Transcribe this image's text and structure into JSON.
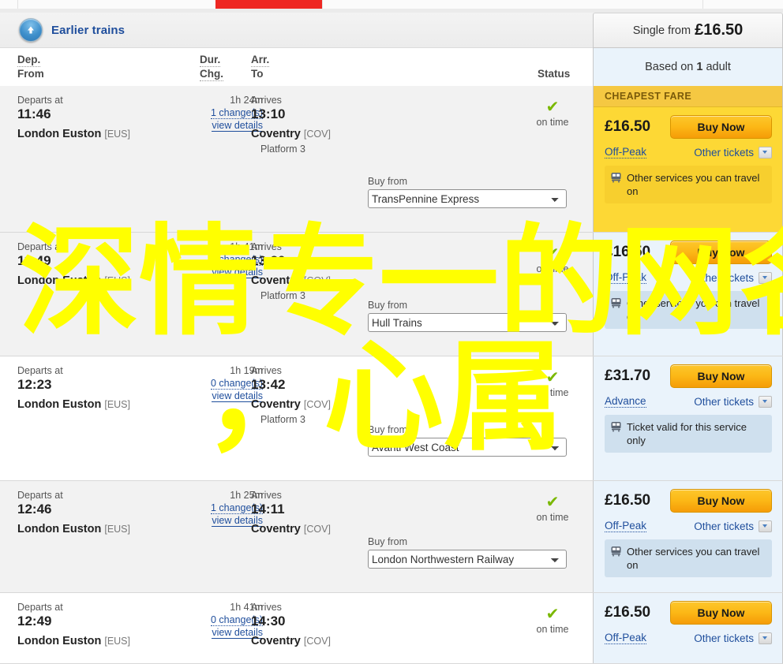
{
  "toolbar": {
    "earlier_trains_label": "Earlier trains",
    "earlier_icon": "up-arrow-icon"
  },
  "columns": {
    "dep": "Dep.",
    "from": "From",
    "dur": "Dur.",
    "chg": "Chg.",
    "arr": "Arr.",
    "to": "To",
    "status": "Status"
  },
  "fare_header": {
    "single_from_label": "Single from",
    "single_from_price": "£16.50",
    "based_on_prefix": "Based on",
    "based_on_count": "1",
    "based_on_suffix": "adult"
  },
  "labels": {
    "departs_at": "Departs at",
    "arrives": "Arrives",
    "view_details": "view details",
    "buy_from": "Buy from",
    "on_time": "on time",
    "buy_now": "Buy Now",
    "other_tickets": "Other tickets",
    "cheapest_fare": "CHEAPEST FARE"
  },
  "results": [
    {
      "depart_time": "11:46",
      "from_station": "London Euston",
      "from_code": "[EUS]",
      "duration": "1h 24m",
      "changes": "1 change(s)",
      "arrive_time": "13:10",
      "to_station": "Coventry",
      "to_code": "[COV]",
      "platform": "Platform 3",
      "status": "on time",
      "operator": "TransPennine Express",
      "price": "£16.50",
      "fare_type": "Off-Peak",
      "note": "Other services you can travel on",
      "cheapest": true,
      "panel": "cheapest",
      "row_shade": "alt"
    },
    {
      "depart_time": "11:49",
      "from_station": "London Euston",
      "from_code": "[EUS]",
      "duration": "1h 41m",
      "changes": "0 change(s)",
      "arrive_time": "13:30",
      "to_station": "Coventry",
      "to_code": "[COV]",
      "platform": "Platform 3",
      "status": "on time",
      "operator": "Hull Trains",
      "price": "£16.50",
      "fare_type": "Off-Peak",
      "note": "Other services you can travel on",
      "cheapest": false,
      "panel": "blue",
      "row_shade": "alt"
    },
    {
      "depart_time": "12:23",
      "from_station": "London Euston",
      "from_code": "[EUS]",
      "duration": "1h 19m",
      "changes": "0 change(s)",
      "arrive_time": "13:42",
      "to_station": "Coventry",
      "to_code": "[COV]",
      "platform": "Platform 3",
      "status": "on time",
      "operator": "Avanti West Coast",
      "price": "£31.70",
      "fare_type": "Advance",
      "note": "Ticket valid for this service only",
      "cheapest": false,
      "panel": "blue",
      "row_shade": "plain"
    },
    {
      "depart_time": "12:46",
      "from_station": "London Euston",
      "from_code": "[EUS]",
      "duration": "1h 25m",
      "changes": "1 change(s)",
      "arrive_time": "14:11",
      "to_station": "Coventry",
      "to_code": "[COV]",
      "platform": "",
      "status": "on time",
      "operator": "London Northwestern Railway",
      "price": "£16.50",
      "fare_type": "Off-Peak",
      "note": "Other services you can travel on",
      "cheapest": false,
      "panel": "blue",
      "row_shade": "alt"
    },
    {
      "depart_time": "12:49",
      "from_station": "London Euston",
      "from_code": "[EUS]",
      "duration": "1h 41m",
      "changes": "0 change(s)",
      "arrive_time": "14:30",
      "to_station": "Coventry",
      "to_code": "[COV]",
      "platform": "",
      "status": "on time",
      "operator": "",
      "price": "£16.50",
      "fare_type": "Off-Peak",
      "note": "",
      "cheapest": false,
      "panel": "blue",
      "row_shade": "plain"
    }
  ],
  "watermark": {
    "line1": "深情专一的网名",
    "line2": "，心属",
    "color": "#ffff00"
  },
  "colors": {
    "accent_red": "#ee2722",
    "cheapest_yellow": "#fdd835",
    "panel_blue": "#eaf3fb",
    "link_blue": "#1f4e9c",
    "tick_green": "#7ab800"
  }
}
